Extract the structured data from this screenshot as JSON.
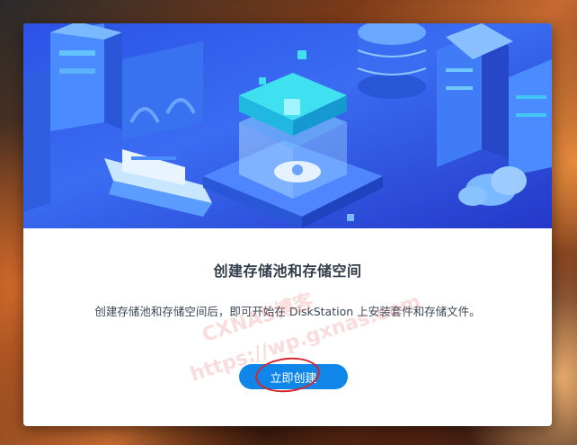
{
  "dialog": {
    "title": "创建存储池和存储空间",
    "description": "创建存储池和存储空间后，即可开始在 DiskStation 上安装套件和存储文件。",
    "create_button": "立即创建"
  },
  "watermark": {
    "line1": "CXNAS博客",
    "line2": "https://wp.gxnas.com"
  },
  "colors": {
    "banner": "#3a6cf2",
    "button": "#0f86e8",
    "highlight": "#d6262e"
  }
}
